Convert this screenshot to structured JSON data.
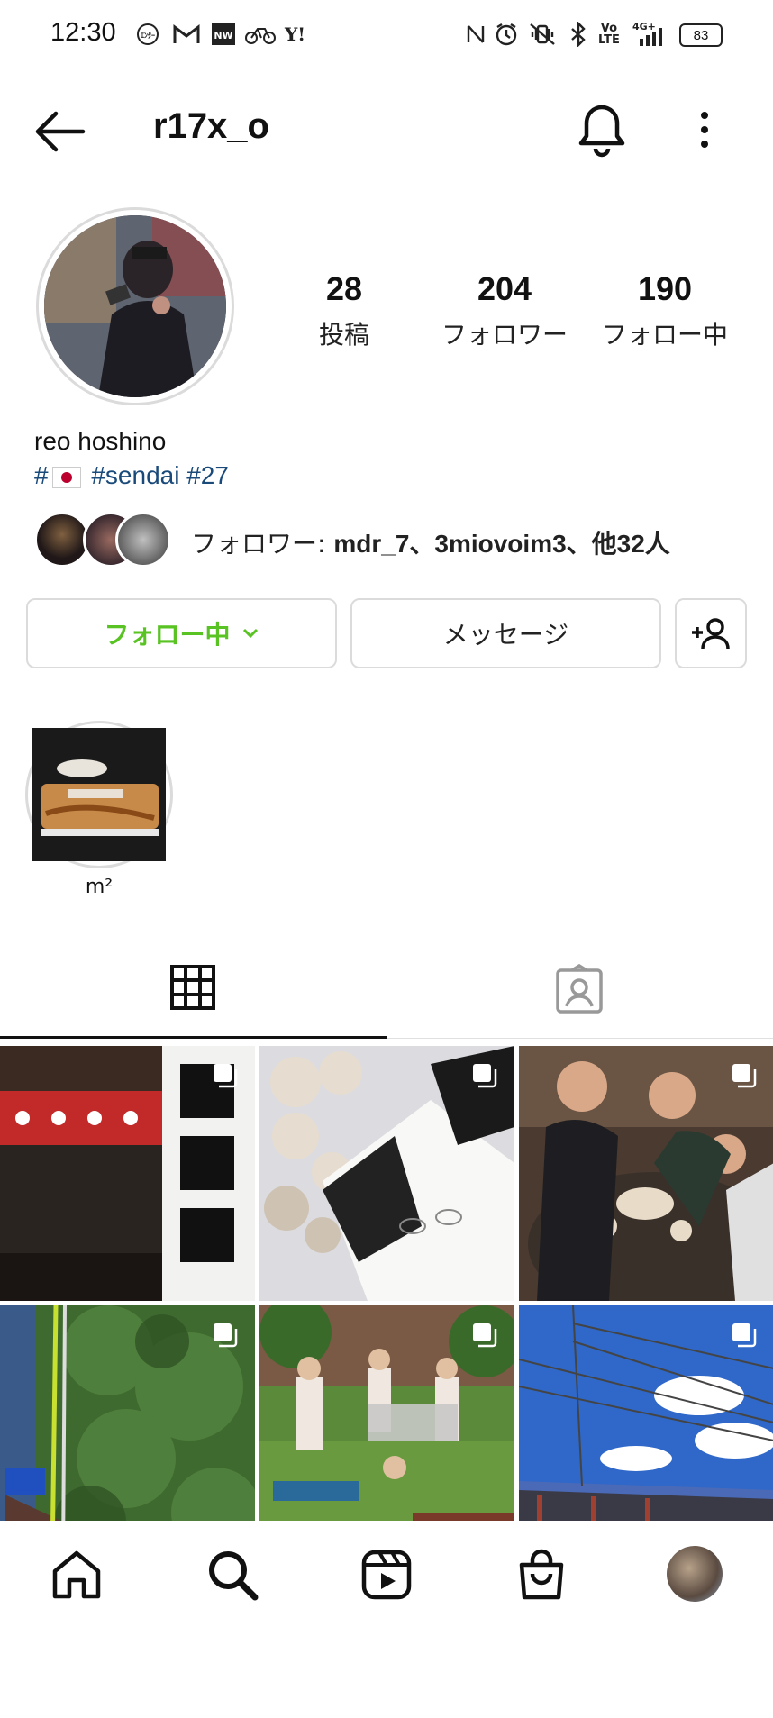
{
  "status_bar": {
    "time": "12:30",
    "battery": "83",
    "left_icons": [
      "ｴﾝﾀｰ",
      "M",
      "NW",
      "bike",
      "Y!"
    ],
    "network": "4G+"
  },
  "header": {
    "username": "r17x_o",
    "icons": [
      "back-arrow-icon",
      "bell-icon",
      "more-vertical-icon"
    ]
  },
  "profile": {
    "stats": [
      {
        "num": "28",
        "label": "投稿"
      },
      {
        "num": "204",
        "label": "フォロワー"
      },
      {
        "num": "190",
        "label": "フォロー中"
      }
    ],
    "name": "reo hoshino",
    "bio_hash": "#",
    "bio_tags": "#sendai #27",
    "followed_by_prefix": "フォロワー: ",
    "followed_by_names": "mdr_7、3miovoim3、他32人"
  },
  "buttons": {
    "following": "フォロー中",
    "message": "メッセージ"
  },
  "highlights": [
    {
      "label": "m²"
    }
  ],
  "tabs": [
    "grid-tab",
    "tagged-tab"
  ],
  "grid_posts": [
    {
      "desc": "shrine lanterns"
    },
    {
      "desc": "flowers and box"
    },
    {
      "desc": "group dinner"
    },
    {
      "desc": "climbing forest"
    },
    {
      "desc": "garden party"
    },
    {
      "desc": "train station sky"
    }
  ],
  "colors": {
    "follow_green": "#58c322",
    "hashtag_blue": "#1a4a7a",
    "border": "#dbdbdb"
  }
}
